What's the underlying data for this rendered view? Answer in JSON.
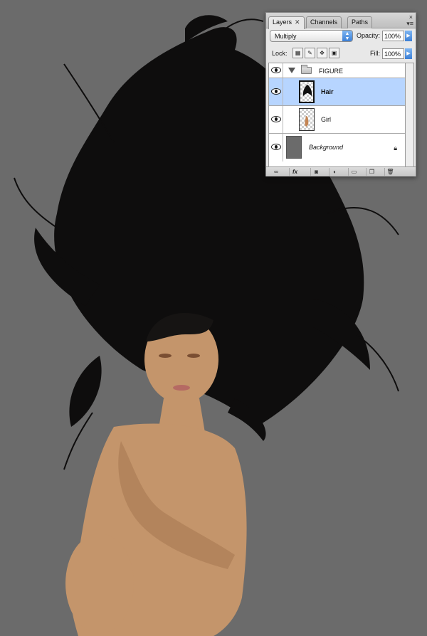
{
  "palette": {
    "tabs": [
      {
        "label": "Layers"
      },
      {
        "label": "Channels"
      },
      {
        "label": "Paths"
      }
    ],
    "close_glyph": "×",
    "tab_close_glyph": "✕",
    "menu_glyph": "▾≡",
    "blend_mode": "Multiply",
    "opacity_label": "Opacity:",
    "opacity_value": "100%",
    "lock_label": "Lock:",
    "fill_label": "Fill:",
    "fill_value": "100%",
    "layers": [
      {
        "name": "FIGURE",
        "type": "group",
        "visible": true,
        "expanded": true,
        "selected": false
      },
      {
        "name": "Hair",
        "type": "layer",
        "visible": true,
        "selected": true
      },
      {
        "name": "Girl",
        "type": "layer",
        "visible": true,
        "selected": false
      },
      {
        "name": "Background",
        "type": "background",
        "visible": true,
        "selected": false,
        "locked": true
      }
    ],
    "bottom_icons": [
      "link-icon",
      "fx-icon",
      "mask-icon",
      "adjustment-icon",
      "new-group-icon",
      "new-layer-icon",
      "trash-icon"
    ],
    "fx_text": "fx",
    "accent_color": "#b7d5ff"
  },
  "canvas": {
    "background_color": "#6b6b6b",
    "subject": "photo of a crouching woman with voluminous black hair"
  }
}
